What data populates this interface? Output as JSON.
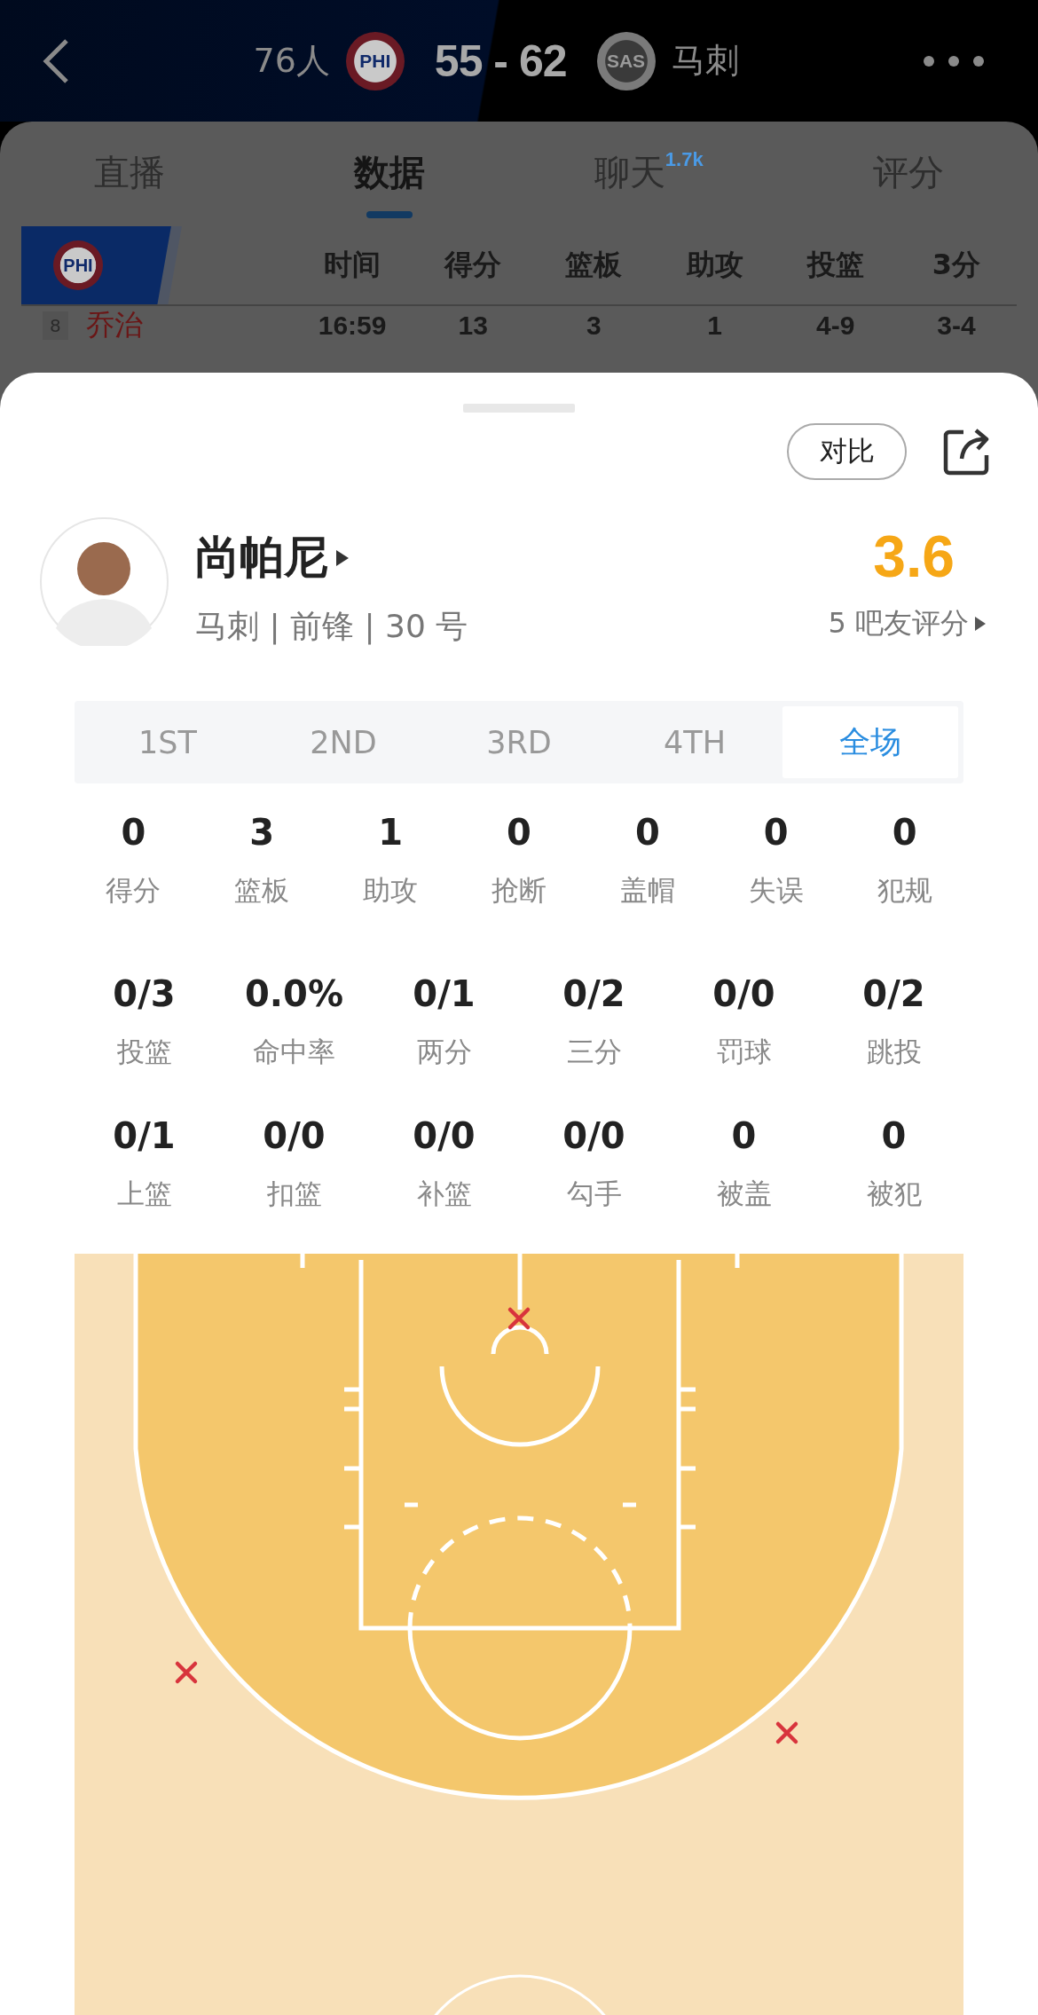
{
  "header": {
    "home_team": "76人",
    "home_logo": "PHI",
    "score": "55 - 62",
    "away_logo": "SAS",
    "away_team": "马刺"
  },
  "tabs": [
    {
      "label": "直播",
      "selected": false
    },
    {
      "label": "数据",
      "selected": true
    },
    {
      "label": "聊天",
      "badge": "1.7k",
      "selected": false
    },
    {
      "label": "评分",
      "selected": false
    }
  ],
  "box_score": {
    "team_logo": "PHI",
    "columns": [
      "时间",
      "得分",
      "篮板",
      "助攻",
      "投篮",
      "3分"
    ],
    "row": {
      "number": "8",
      "name": "乔治",
      "values": [
        "16:59",
        "13",
        "3",
        "1",
        "4-9",
        "3-4"
      ]
    }
  },
  "sheet": {
    "compare_button": "对比",
    "player": {
      "name": "尚帕尼",
      "info": "马刺 | 前锋 | 30 号",
      "rating": "3.6",
      "rating_count": "5 吧友评分"
    },
    "periods": [
      {
        "label": "1ST",
        "selected": false
      },
      {
        "label": "2ND",
        "selected": false
      },
      {
        "label": "3RD",
        "selected": false
      },
      {
        "label": "4TH",
        "selected": false
      },
      {
        "label": "全场",
        "selected": true
      }
    ],
    "stat_rows": [
      [
        {
          "value": "0",
          "label": "得分"
        },
        {
          "value": "3",
          "label": "篮板"
        },
        {
          "value": "1",
          "label": "助攻"
        },
        {
          "value": "0",
          "label": "抢断"
        },
        {
          "value": "0",
          "label": "盖帽"
        },
        {
          "value": "0",
          "label": "失误"
        },
        {
          "value": "0",
          "label": "犯规"
        }
      ],
      [
        {
          "value": "0/3",
          "label": "投篮"
        },
        {
          "value": "0.0%",
          "label": "命中率"
        },
        {
          "value": "0/1",
          "label": "两分"
        },
        {
          "value": "0/2",
          "label": "三分"
        },
        {
          "value": "0/0",
          "label": "罚球"
        },
        {
          "value": "0/2",
          "label": "跳投"
        }
      ],
      [
        {
          "value": "0/1",
          "label": "上篮"
        },
        {
          "value": "0/0",
          "label": "扣篮"
        },
        {
          "value": "0/0",
          "label": "补篮"
        },
        {
          "value": "0/0",
          "label": "勾手"
        },
        {
          "value": "0",
          "label": "被盖"
        },
        {
          "value": "0",
          "label": "被犯"
        }
      ]
    ]
  }
}
